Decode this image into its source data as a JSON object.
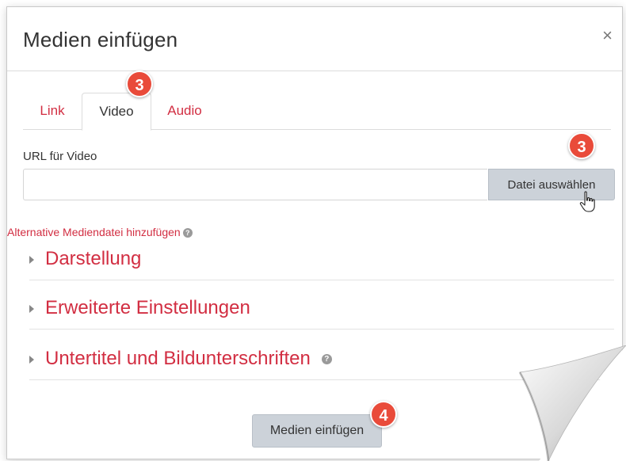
{
  "dialog": {
    "title": "Medien einfügen",
    "close_glyph": "×"
  },
  "tabs": [
    {
      "label": "Link",
      "active": false
    },
    {
      "label": "Video",
      "active": true
    },
    {
      "label": "Audio",
      "active": false
    }
  ],
  "badges": {
    "tab_video": "3",
    "choose_file": "3",
    "insert": "4"
  },
  "url": {
    "label": "URL für Video",
    "value": "",
    "choose_button": "Datei auswählen"
  },
  "alt_media_link": "Alternative Mediendatei hinzufügen",
  "help_glyph": "?",
  "sections": [
    {
      "label": "Darstellung",
      "help": false
    },
    {
      "label": "Erweiterte Einstellungen",
      "help": false
    },
    {
      "label": "Untertitel und Bildunterschriften",
      "help": true
    }
  ],
  "footer": {
    "insert_button": "Medien einfügen"
  },
  "colors": {
    "accent_red": "#d22e42",
    "badge_red": "#e94b3a",
    "button_grey": "#ccd2d9"
  },
  "icons": {
    "close": "close-icon",
    "help": "help-icon",
    "expand": "chevron-right-icon",
    "cursor": "hand-pointer-icon"
  }
}
